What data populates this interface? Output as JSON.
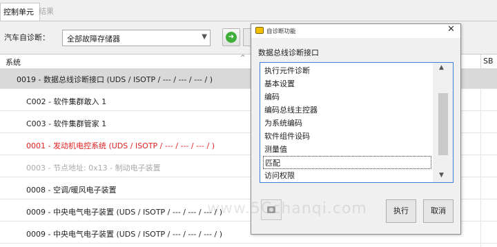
{
  "tabs": [
    {
      "label": "控制单元",
      "active": true
    },
    {
      "label": "结果",
      "active": false
    }
  ],
  "toolbar": {
    "diag_label": "汽车自诊断：",
    "memory_select_value": "全部故障存储器",
    "go_icon": "arrow-right-icon"
  },
  "list": {
    "column_system": "系统",
    "column_sb": "SB",
    "sort_icon": "sort-up-icon",
    "rows": [
      {
        "text": "0019 - 数据总线诊断接口  (UDS / ISOTP / --- / --- / --- / )",
        "style": "selected"
      },
      {
        "text": "C002 - 软件集群敢入 1",
        "style": "child"
      },
      {
        "text": "C003 - 软件集群管家 1",
        "style": "child"
      },
      {
        "text": "0001 - 发动机电控系统  (UDS / ISOTP / --- / --- / --- / )",
        "style": "error"
      },
      {
        "text": "0003 - 节点地址: 0x13 - 制动电子装置",
        "style": "disabled"
      },
      {
        "text": "0008 - 空调/暖风电子装置",
        "style": "normal"
      },
      {
        "text": "0009 - 中央电气电子装置  (UDS / ISOTP / --- / --- / --- / )",
        "style": "normal"
      },
      {
        "text": "0009 - 中央电气电子装置  (UDS / ISOTP / --- / --- / --- / )",
        "style": "normal"
      }
    ]
  },
  "dialog": {
    "title": "自诊断功能",
    "subtitle": "数据总线诊断接口",
    "functions": [
      "执行元件诊断",
      "基本设置",
      "编码",
      "编码总线主控器",
      "为系统编码",
      "软件组件设码",
      "测量值",
      "匹配",
      "访问权限"
    ],
    "focused_index": 7,
    "execute_label": "执行",
    "cancel_label": "取消",
    "camera_icon": "camera-icon"
  },
  "watermark": "www.5Cchanqi.com",
  "colors": {
    "error_text": "#e02020",
    "disabled_text": "#a9a9a9",
    "selected_row": "#d9d9d9",
    "list_border": "#3c7fd6"
  }
}
